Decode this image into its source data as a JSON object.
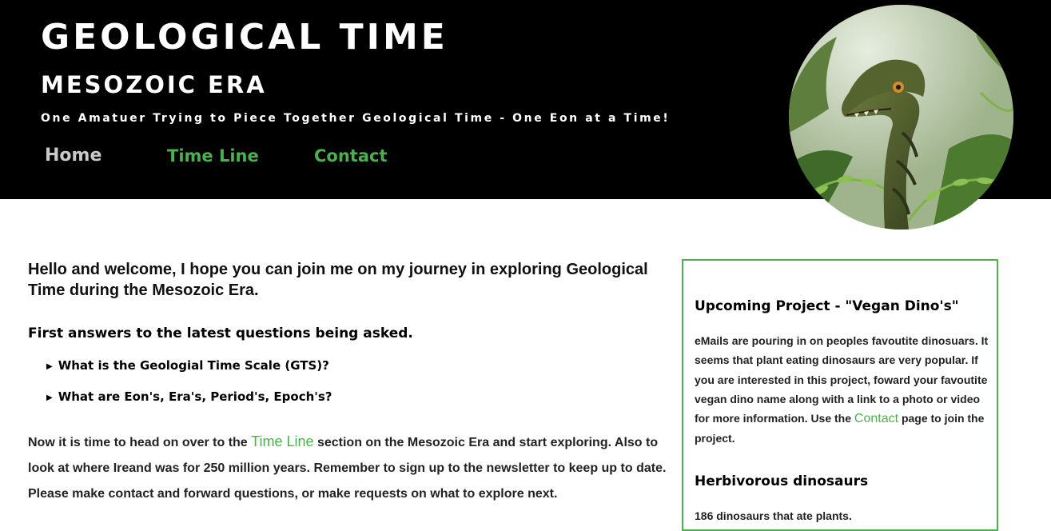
{
  "header": {
    "title": "GEOLOGICAL TIME",
    "subtitle": "MESOZOIC ERA",
    "tagline": "One Amatuer Trying to Piece Together Geological Time - One Eon at a Time!"
  },
  "nav": {
    "home": "Home",
    "timeline": "Time Line",
    "contact": "Contact"
  },
  "colors": {
    "accent": "#4caf50",
    "header_bg": "#000000",
    "nav_inactive": "#c9c9c9"
  },
  "main": {
    "intro": "Hello and welcome, I hope you can join me on my journey in exploring Geological Time during the Mesozoic Era.",
    "section_heading": "First answers to the latest questions being asked.",
    "faq": [
      "What is the Geologial Time Scale (GTS)?",
      "What are Eon's, Era's, Period's, Epoch's?"
    ],
    "body_before_link": "Now it is time to head on over to the ",
    "body_link": "Time Line",
    "body_after_link": " section on the Mesozoic Era and start exploring. Also to look at where Ireand was for 250 million years. Remember to sign up to the newsletter to keep up to date. Please make contact and forward questions, or make requests on what to explore next."
  },
  "sidebar": {
    "project_heading": "Upcoming Project - \"Vegan Dino's\"",
    "project_text_before_link": "eMails are pouring in on peoples favoutite dinosuars. It seems that plant eating dinosaurs are very popular. If you are interested in this project, foward your favoutite vegan dino name along with a link to a photo or video for more information. Use the ",
    "project_link": "Contact",
    "project_text_after_link": " page to join the project.",
    "herb_heading": "Herbivorous dinosaurs",
    "herb_text": "186 dinosaurs that ate plants."
  }
}
